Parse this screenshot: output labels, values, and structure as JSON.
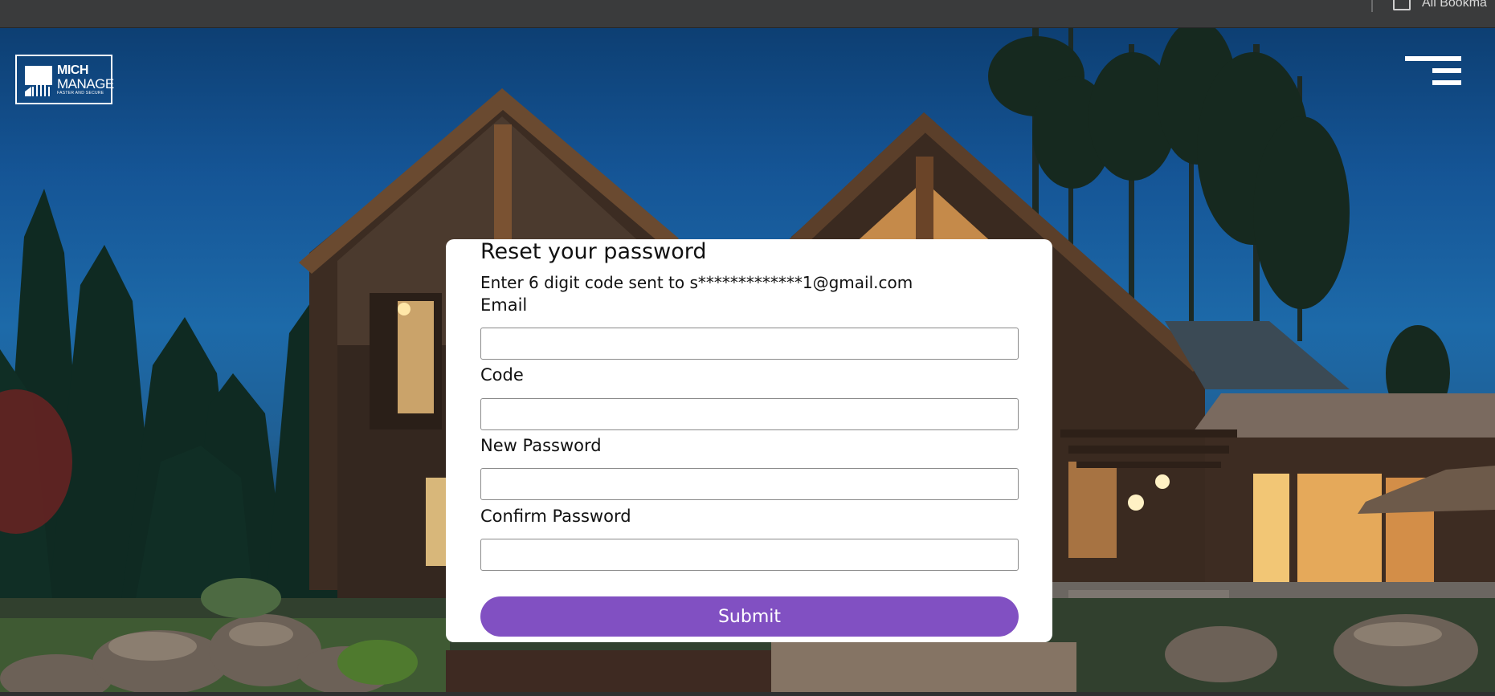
{
  "browser": {
    "bookmarks_label": "All Bookma"
  },
  "brand": {
    "line1": "MICH",
    "line2": "MANAGE",
    "tagline": "FASTER AND SECURE"
  },
  "header": {
    "menu_icon": "hamburger-menu-icon"
  },
  "form": {
    "title": "Reset your password",
    "subtitle": "Enter 6 digit code sent to s*************1@gmail.com",
    "fields": [
      {
        "label": "Email",
        "value": "",
        "placeholder": ""
      },
      {
        "label": "Code",
        "value": "",
        "placeholder": ""
      },
      {
        "label": "New Password",
        "value": "",
        "placeholder": ""
      },
      {
        "label": "Confirm Password",
        "value": "",
        "placeholder": ""
      }
    ],
    "submit_label": "Submit"
  },
  "colors": {
    "accent": "#8150c2",
    "card_background": "#ffffff",
    "sky": "#155596"
  }
}
